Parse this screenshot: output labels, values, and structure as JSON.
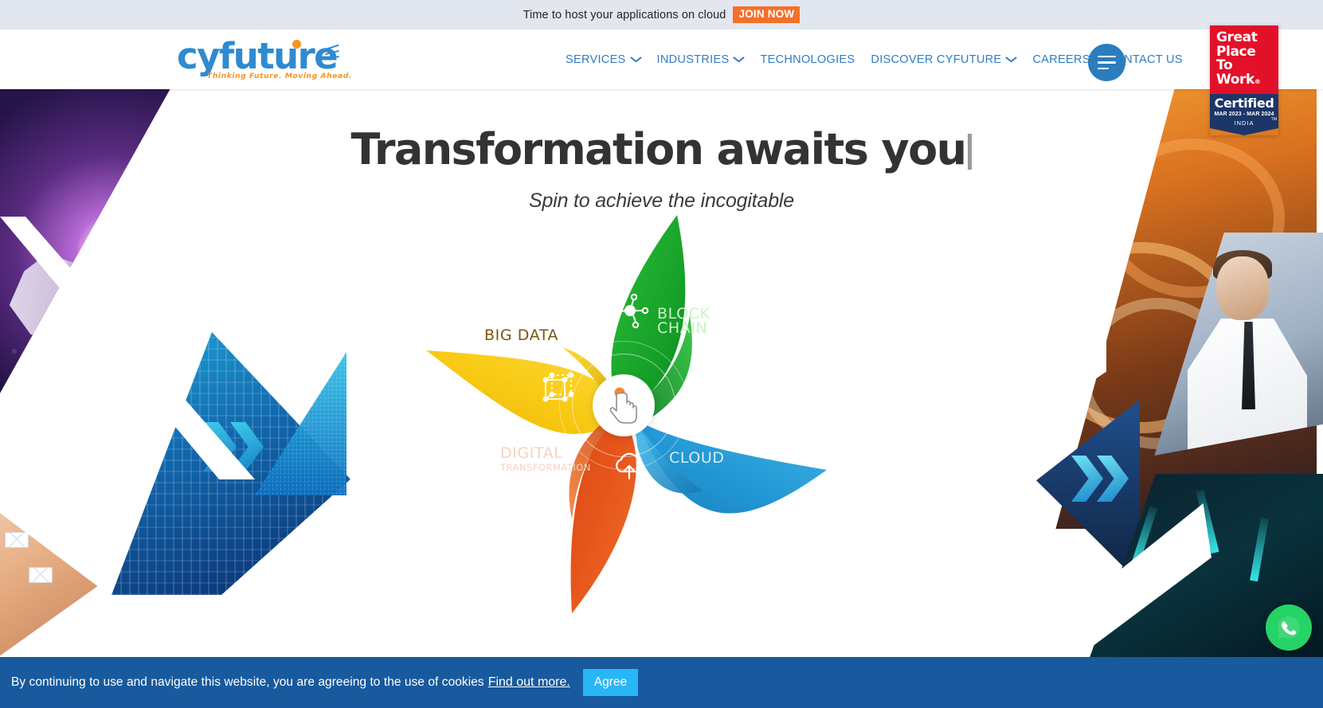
{
  "announcement": {
    "text": "Time to host your applications on cloud",
    "cta_label": "JOIN NOW",
    "cta_color": "#f4702a",
    "bg_color": "#e2e6ee"
  },
  "header": {
    "logo": {
      "wordmark": "cyfuture",
      "tagline": "Thinking Future. Moving Ahead.",
      "color": "#2f8ad0",
      "accent_color": "#f7941e"
    },
    "nav": [
      {
        "label": "SERVICES",
        "has_caret": true
      },
      {
        "label": "INDUSTRIES",
        "has_caret": true
      },
      {
        "label": "TECHNOLOGIES",
        "has_caret": false
      },
      {
        "label": "DISCOVER CYFUTURE",
        "has_caret": true
      },
      {
        "label": "CAREERS",
        "has_caret": false
      },
      {
        "label": "CONTACT US",
        "has_caret": false
      }
    ],
    "nav_color": "#2f7dc4",
    "menu_button": "menu-icon"
  },
  "badge": {
    "line1": "Great",
    "line2": "Place",
    "line3": "To",
    "line4": "Work",
    "registered": "®",
    "certified": "Certified",
    "dates": "MAR 2023 - MAR 2024",
    "country": "INDIA",
    "tm": "TM",
    "red": "#e3102a",
    "navy": "#1b3668"
  },
  "hero": {
    "title": "Transformation awaits you",
    "subtitle": "Spin to achieve the incogitable"
  },
  "pinwheel": {
    "center_icon": "hand-pointer-icon",
    "blades": [
      {
        "label": "BIG DATA",
        "color": "#f5c211",
        "icon": "network-nodes-icon",
        "text_color": "#7a5510"
      },
      {
        "label": "BLOCK CHAIN",
        "line1": "BLOCK",
        "line2": "CHAIN",
        "color": "#15a82b",
        "icon": "cube-icon",
        "text_color": "#cdf0c8"
      },
      {
        "label": "CLOUD",
        "color": "#29a3dc",
        "icon": "cloud-upload-icon",
        "text_color": "#d9ebf7"
      },
      {
        "label": "DIGITAL TRANSFORMATION",
        "line1": "DIGITAL",
        "line2": "TRANSFORMATION",
        "color": "#e8571f",
        "icon": "cube-wireframe-icon",
        "text_color": "#f6d2c4"
      }
    ]
  },
  "cookie_bar": {
    "text": "By continuing to use and navigate this website, you are agreeing to the use of cookies",
    "link_label": "Find out more.",
    "button_label": "Agree",
    "bg_color": "#185a9d",
    "button_color": "#29b6f6"
  },
  "chat": {
    "icon": "whatsapp-icon",
    "color": "#25d366"
  }
}
